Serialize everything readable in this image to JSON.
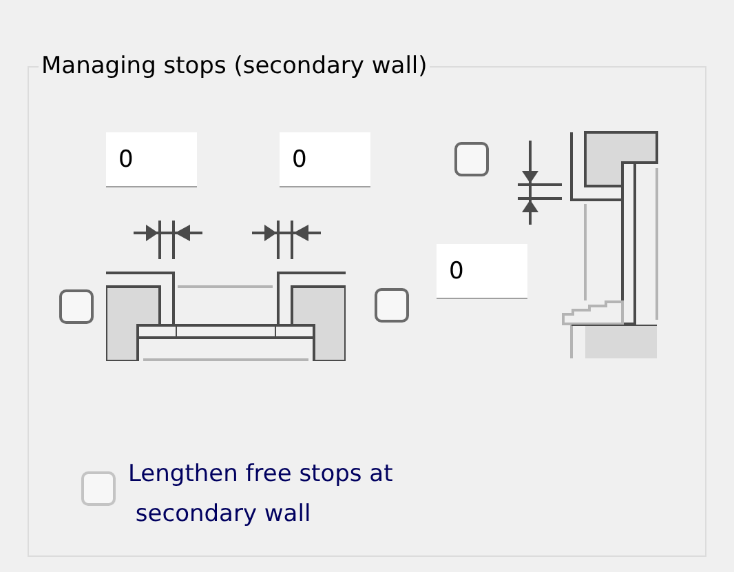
{
  "group": {
    "title": "Managing stops (secondary wall)"
  },
  "fields": [
    {
      "value": "0"
    },
    {
      "value": "0"
    },
    {
      "value": "0"
    }
  ],
  "checkboxes": [
    {
      "checked": false
    },
    {
      "checked": false
    },
    {
      "checked": false
    }
  ],
  "option": {
    "label": "Lengthen free stops at\n secondary wall",
    "checked": false,
    "disabled": true
  }
}
